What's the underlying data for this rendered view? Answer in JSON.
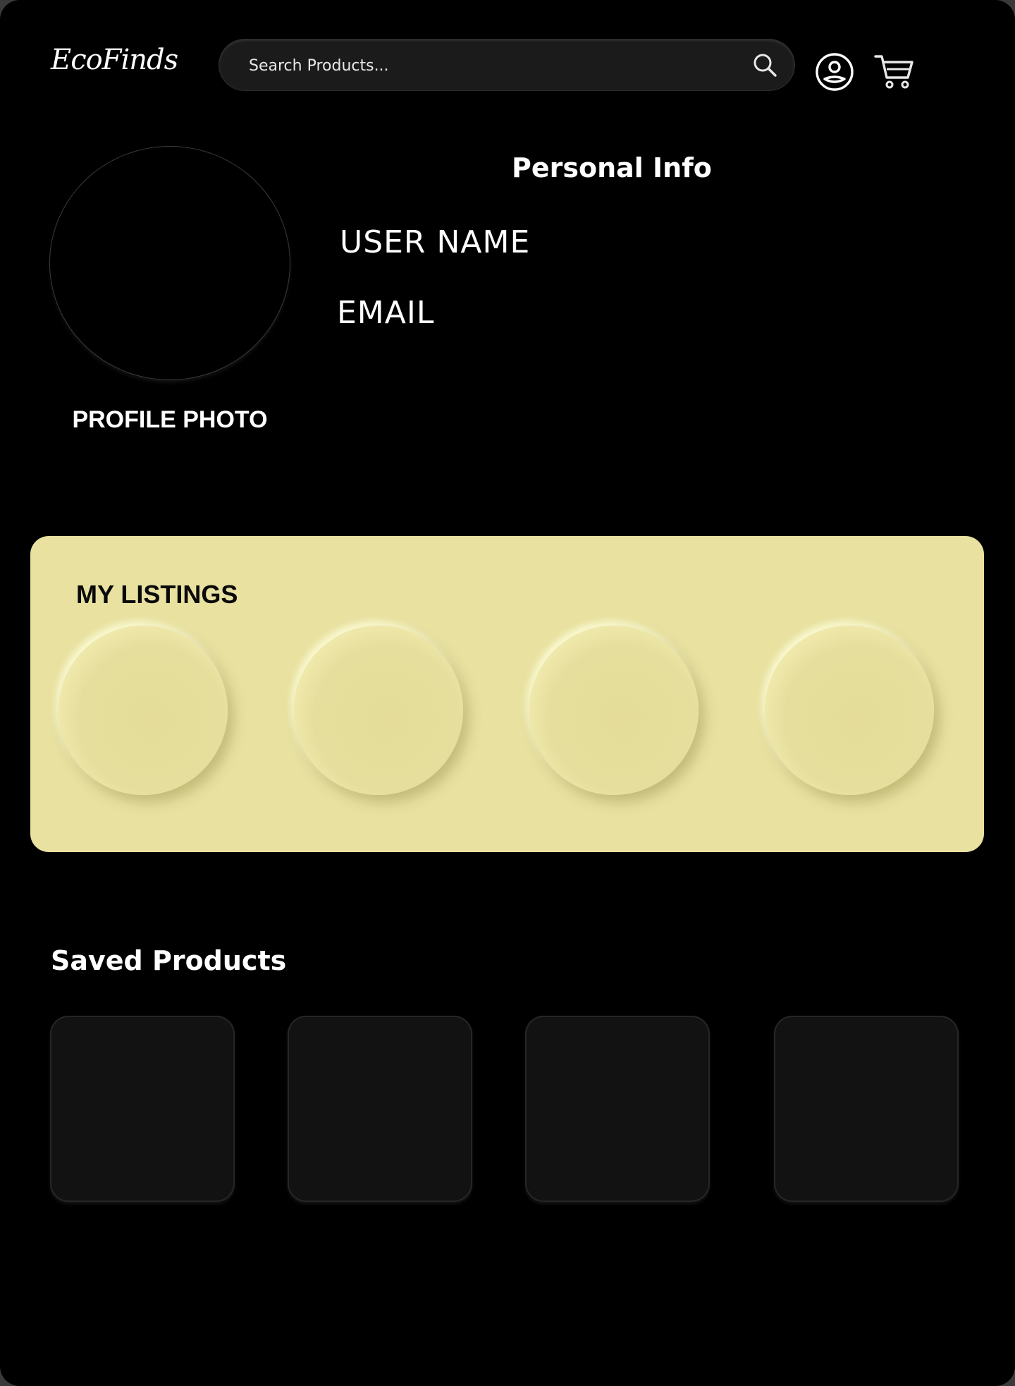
{
  "header": {
    "logo": "EcoFinds",
    "search": {
      "placeholder": "Search Products..."
    },
    "icons": [
      "search-icon",
      "user-icon",
      "cart-icon"
    ]
  },
  "profile": {
    "photo_label": "PROFILE PHOTO",
    "section_title": "Personal Info",
    "username_label": "USER NAME",
    "email_label": "EMAIL"
  },
  "listings": {
    "title": "MY LISTINGS",
    "items": [
      {},
      {},
      {},
      {}
    ]
  },
  "saved": {
    "title": "Saved Products",
    "items": [
      {},
      {},
      {},
      {}
    ]
  },
  "colors": {
    "background": "#000000",
    "listings_panel": "#e8e1a0",
    "text": "#ffffff"
  }
}
